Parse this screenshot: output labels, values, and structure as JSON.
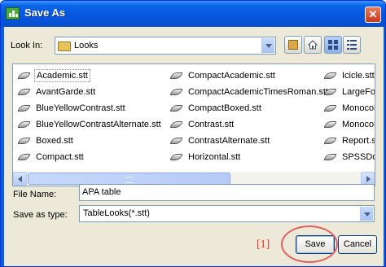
{
  "window": {
    "title": "Save As",
    "close_glyph": "✕"
  },
  "look_in": {
    "label": "Look In:",
    "value": "Looks"
  },
  "toolbar": {
    "icons": [
      "up-folder-icon",
      "home-icon",
      "list-view-icon",
      "details-view-icon"
    ]
  },
  "files": {
    "columns": [
      [
        "Academic.stt",
        "AvantGarde.stt",
        "BlueYellowContrast.stt",
        "BlueYellowContrastAlternate.stt",
        "Boxed.stt",
        "Compact.stt"
      ],
      [
        "CompactAcademic.stt",
        "CompactAcademicTimesRoman.stt",
        "CompactBoxed.stt",
        "Contrast.stt",
        "ContrastAlternate.stt",
        "Horizontal.stt"
      ],
      [
        "Icicle.stt",
        "LargeFo",
        "Monocol",
        "Monocol",
        "Report.s",
        "SPSSDo"
      ]
    ],
    "selected": "Academic.stt"
  },
  "file_name": {
    "label": "File Name:",
    "value": "APA table"
  },
  "save_type": {
    "label": "Save as type:",
    "value": "TableLooks(*.stt)"
  },
  "annotation": {
    "marker": "[1]",
    "color": "#e5332a"
  },
  "buttons": {
    "save": "Save",
    "cancel": "Cancel"
  },
  "colors": {
    "titlebar": "#0758e0",
    "dialog_bg": "#ece9d8",
    "border": "#7f9db9"
  }
}
